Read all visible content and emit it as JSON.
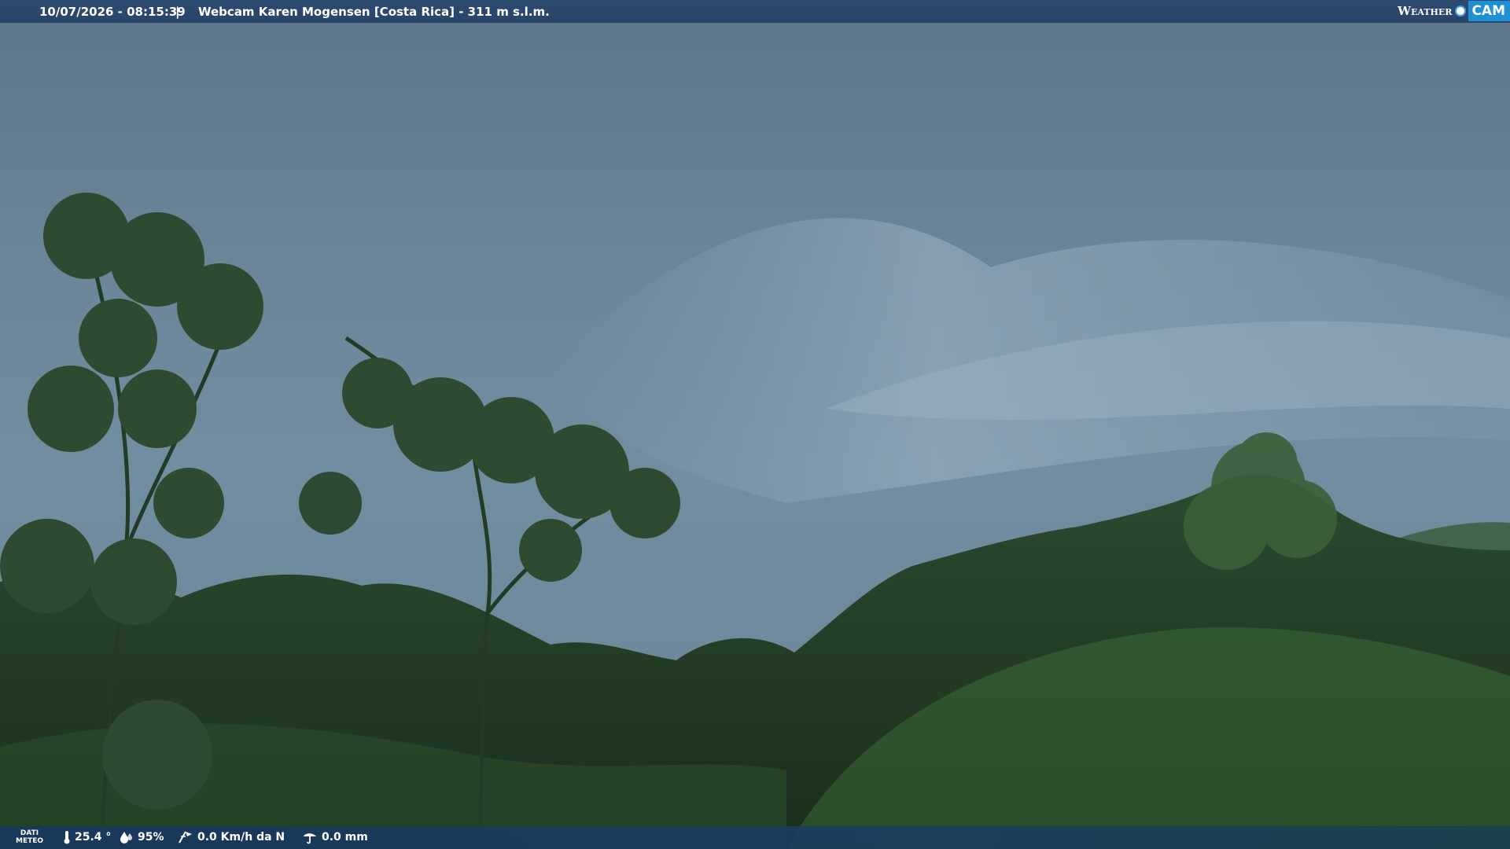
{
  "header": {
    "datetime": "10/07/2026 - 08:15:39",
    "separator": "|",
    "title": "Webcam Karen Mogensen [Costa Rica] - 311 m s.l.m."
  },
  "brand": {
    "weather": "Weather",
    "cam": "CAM",
    "accent": "#1f8fd6"
  },
  "footer": {
    "label_line1": "DATI",
    "label_line2": "METEO",
    "temperature": "25.4 °",
    "humidity": "95%",
    "wind": "0.0 Km/h da N",
    "rain": "0.0 mm"
  },
  "icons": {
    "temperature": "thermometer-icon",
    "humidity": "humidity-drop-icon",
    "wind": "wind-icon",
    "rain": "rain-gauge-icon"
  }
}
